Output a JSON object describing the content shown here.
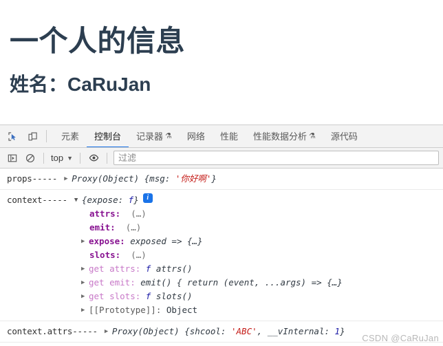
{
  "page": {
    "title": "一个人的信息",
    "subtitle": "姓名：CaRuJan"
  },
  "devtools": {
    "toolbar_icons": [
      {
        "name": "inspect-element-icon"
      },
      {
        "name": "device-toolbar-icon"
      }
    ],
    "tabs": [
      {
        "label": "元素",
        "active": false,
        "flask": false
      },
      {
        "label": "控制台",
        "active": true,
        "flask": false
      },
      {
        "label": "记录器",
        "active": false,
        "flask": true
      },
      {
        "label": "网络",
        "active": false,
        "flask": false
      },
      {
        "label": "性能",
        "active": false,
        "flask": false
      },
      {
        "label": "性能数据分析",
        "active": false,
        "flask": true
      },
      {
        "label": "源代码",
        "active": false,
        "flask": false
      }
    ],
    "filterbar": {
      "sidebar_toggle": "console-sidebar-icon",
      "clear_console": "clear-console-icon",
      "context": "top",
      "caret": "▼",
      "eye_icon": "live-expression-eye-icon",
      "filter_placeholder": "过滤"
    },
    "accent_color": "#1a73e8"
  },
  "console": {
    "rows": [
      {
        "label": "props-----",
        "arrow": "▶",
        "type": "Proxy(Object)",
        "preview_open": "{",
        "prop": "msg:",
        "value": "'你好啊'",
        "preview_close": "}"
      },
      {
        "label": "context-----",
        "arrow": "▼",
        "preview_open": "{",
        "prop": "expose:",
        "value": "f",
        "preview_close": "}",
        "badge": "i"
      }
    ],
    "properties": [
      {
        "arrow": "",
        "name": "attrs:",
        "value": "(…)",
        "kind": "plain"
      },
      {
        "arrow": "",
        "name": "emit:",
        "value": "(…)",
        "kind": "plain"
      },
      {
        "arrow": "▶",
        "name": "expose:",
        "value": "exposed => {…}",
        "kind": "plain"
      },
      {
        "arrow": "",
        "name": "slots:",
        "value": "(…)",
        "kind": "plain"
      },
      {
        "arrow": "▶",
        "name": "get attrs:",
        "value_f": "f",
        "value": "attrs()",
        "kind": "getter"
      },
      {
        "arrow": "▶",
        "name": "get emit:",
        "value": "emit() { return (event, ...args) => {…}",
        "kind": "getter"
      },
      {
        "arrow": "▶",
        "name": "get slots:",
        "value_f": "f",
        "value": "slots()",
        "kind": "getter"
      },
      {
        "arrow": "▶",
        "name": "[[Prototype]]:",
        "value": "Object",
        "kind": "proto"
      }
    ],
    "last_row": {
      "label": "context.attrs-----",
      "arrow": "▶",
      "type": "Proxy(Object)",
      "preview_open": "{",
      "prop1": "shcool:",
      "value1": "'ABC'",
      "sep": ", ",
      "prop2": "__vInternal:",
      "value2": "1",
      "preview_close": "}"
    }
  },
  "watermark": "CSDN @CaRuJan"
}
